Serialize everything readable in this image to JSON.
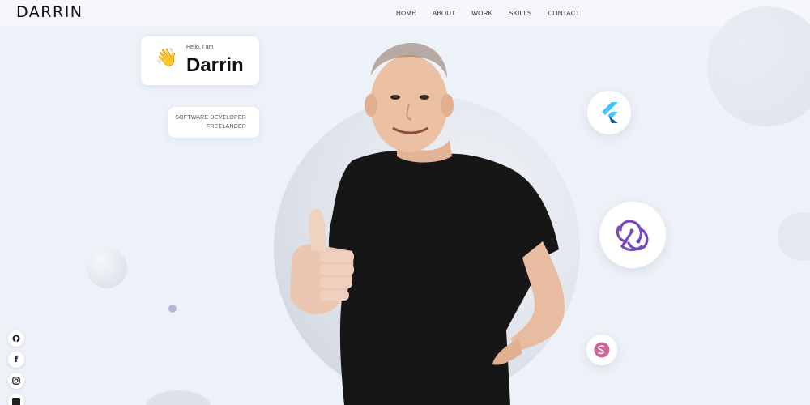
{
  "header": {
    "logo": "DARRIN",
    "nav": [
      {
        "label": "HOME"
      },
      {
        "label": "ABOUT"
      },
      {
        "label": "WORK"
      },
      {
        "label": "SKILLS"
      },
      {
        "label": "CONTACT"
      }
    ]
  },
  "hero": {
    "greeting": "Hello, I am",
    "name": "Darrin",
    "wave_emoji": "👋",
    "role_line_1": "SOFTWARE DEVELOPER",
    "role_line_2": "FREELANCER"
  },
  "skill_badges": [
    {
      "icon": "flutter-icon"
    },
    {
      "icon": "redux-icon"
    },
    {
      "icon": "sass-icon"
    }
  ],
  "social": [
    {
      "icon": "github-icon"
    },
    {
      "icon": "facebook-icon"
    },
    {
      "icon": "instagram-icon"
    },
    {
      "icon": "linkedin-icon"
    }
  ],
  "colors": {
    "background": "#edf2f8",
    "flutter_light": "#47c5fb",
    "flutter_dark": "#0f5ba8",
    "redux": "#764abc",
    "sass": "#cd6799"
  }
}
